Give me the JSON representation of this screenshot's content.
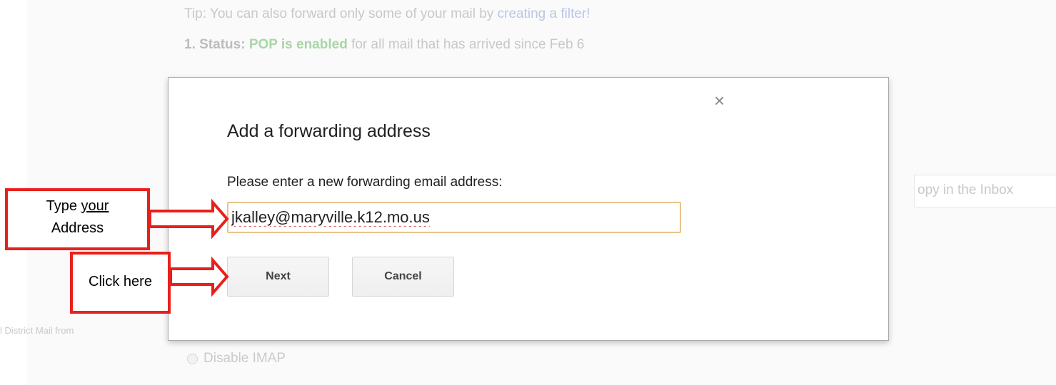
{
  "background": {
    "tip_prefix": "Tip: You can also forward only some of your mail by",
    "tip_link": "creating a filter!",
    "status_label": "1. Status:",
    "status_pop": "POP is enabled",
    "status_rest": "for all mail that has arrived since Feb 6",
    "inbox_fragment": "opy in the Inbox",
    "district_fragment": "l District Mail from",
    "imap_option": "Disable IMAP"
  },
  "dialog": {
    "close_glyph": "×",
    "title": "Add a forwarding address",
    "prompt": "Please enter a new forwarding email address:",
    "email_value": "jkalley@maryville.k12.mo.us",
    "next_label": "Next",
    "cancel_label": "Cancel"
  },
  "annotations": {
    "type_label_1": "Type",
    "type_label_2": "your",
    "type_label_3": "Address",
    "click_label": "Click here",
    "color": "#e8201b"
  }
}
